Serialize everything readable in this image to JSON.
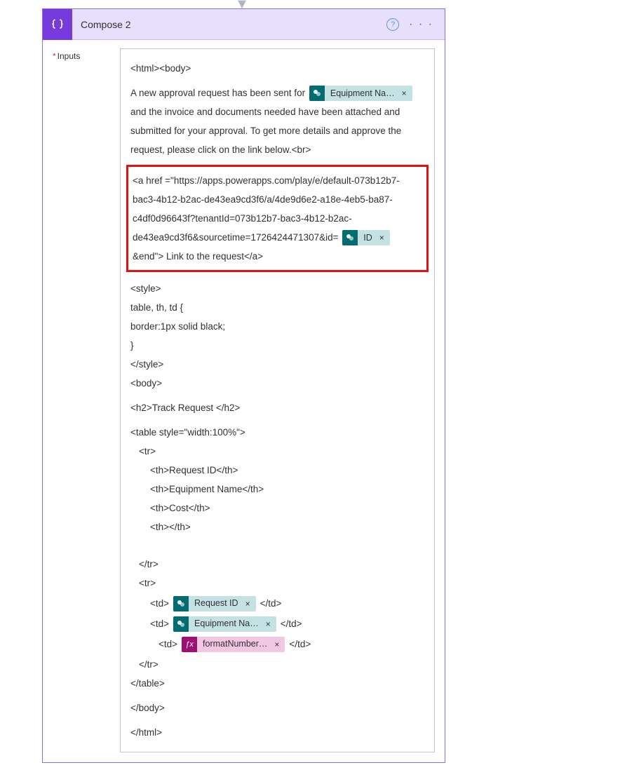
{
  "arrow_glyph": "▼",
  "card": {
    "title": "Compose 2",
    "icon_name": "compose-braces-icon",
    "help_glyph": "?",
    "more_glyph": "· · ·"
  },
  "label": {
    "required_marker": "*",
    "inputs": "Inputs"
  },
  "content": {
    "l_htmlbody": "<html><body>",
    "para1_a": "A new approval request has been sent for ",
    "para1_b": " and the invoice and documents needed have been attached and submitted for your approval. To get more details and approve the request,  please click on the link below.<br>",
    "link_block": {
      "part1": "<a href =\"https://apps.powerapps.com/play/e/default-073b12b7-bac3-4b12-b2ac-de43ea9cd3f6/a/4de9d6e2-a18e-4eb5-ba87-c4df0d96643f?tenantId=073b12b7-bac3-4b12-b2ac-de43ea9cd3f6&sourcetime=1726424471307&id=",
      "part2": " &end\">  Link to the request</a>"
    },
    "style_open": "<style>",
    "style_rule": "table, th, td {",
    "style_border": "  border:1px solid black;",
    "style_close_brace": "}",
    "style_close": "</style>",
    "body_open": "<body>",
    "h2": "<h2>Track Request </h2>",
    "table_open": "<table style=\"width:100%\">",
    "tr_open": "<tr>",
    "th_reqid": "<th>Request ID</th>",
    "th_equip": "<th>Equipment Name</th>",
    "th_cost": "<th>Cost</th>",
    "th_empty": "<th></th>",
    "tr_close": "</tr>",
    "tr_open2": "<tr>",
    "td_open": "<td>",
    "td_close": "</td>",
    "tr_close2": "</tr>",
    "table_close": "</table>",
    "body_close": "</body>",
    "html_close": "</html>"
  },
  "tokens": {
    "equip_name": {
      "label": "Equipment Na…",
      "x": "×",
      "icon": "SP"
    },
    "id": {
      "label": "ID",
      "x": "×",
      "icon": "SP"
    },
    "request_id": {
      "label": "Request ID",
      "x": "×",
      "icon": "SP"
    },
    "equip_name2": {
      "label": "Equipment Na…",
      "x": "×",
      "icon": "SP"
    },
    "format_num": {
      "label": "formatNumber…",
      "x": "×",
      "icon": "fx"
    }
  }
}
